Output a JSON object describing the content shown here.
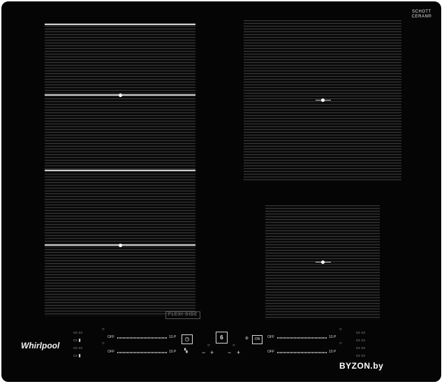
{
  "brand": {
    "logo": "Whirlpool",
    "glass_top": "SCHOTT",
    "glass_bottom": "CERAN®",
    "flexi_label_a": "FLEXI",
    "flexi_label_b": "SIDE",
    "watermark": "BYZON.by"
  },
  "controls": {
    "left_slider_top": {
      "off_label": "OFF",
      "max_label": "10 P"
    },
    "left_slider_bottom": {
      "off_label": "OFF",
      "max_label": "10 P"
    },
    "right_slider_top": {
      "off_label": "OFF",
      "max_label": "10 P"
    },
    "right_slider_bottom": {
      "off_label": "OFF",
      "max_label": "10 P"
    },
    "timer_icon": "clock-icon",
    "sixth_sense_label": "6",
    "on_off_label": "ON",
    "minus_label": "−",
    "plus_label": "+"
  }
}
